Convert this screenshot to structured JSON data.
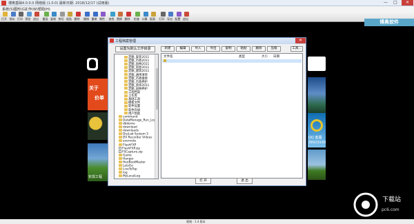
{
  "window": {
    "title": "博奥基础4.0.0.0 网络版 (1.0.0) 最新日期: 2018/12/17 (试用版)",
    "min_glyph": "—",
    "max_glyph": "□",
    "close_glyph": "✕"
  },
  "menu": [
    "系统(S)",
    "图形(G)",
    "工作(W)",
    "帮助(H)"
  ],
  "toolbar": {
    "items": [
      {
        "label": "打开",
        "color": "#e0b43a"
      },
      {
        "label": "保存",
        "color": "#4b7bc8"
      },
      {
        "label": "打印",
        "color": "#666666"
      },
      {
        "label": "预览",
        "color": "#5a9bd5"
      },
      {
        "label": "退出",
        "color": "#c94a3a"
      },
      {
        "label": "重画",
        "color": "#6ab04c"
      },
      {
        "label": "复制",
        "color": "#3a8bc9"
      },
      {
        "label": "剪切",
        "color": "#999999"
      },
      {
        "label": "粘贴",
        "color": "#c9a23a"
      },
      {
        "label": "删除",
        "color": "#cc3333"
      },
      {
        "label": "撤销",
        "color": "#3a6fc9"
      },
      {
        "label": "重做",
        "color": "#3a6fc9"
      },
      {
        "label": "属性",
        "color": "#8a5ac9"
      },
      {
        "label": "查找",
        "color": "#3aa0c9"
      },
      {
        "label": "替换",
        "color": "#c9703a"
      },
      {
        "label": "删除",
        "color": "#cc3333"
      },
      {
        "label": "检查",
        "color": "#6ab04c"
      },
      {
        "label": "计算",
        "color": "#3a8bc9"
      },
      {
        "label": "报表",
        "color": "#c9a23a"
      },
      {
        "label": "打印",
        "color": "#666666"
      },
      {
        "label": "导出",
        "color": "#4b7bc8"
      },
      {
        "label": "配置",
        "color": "#8a5ac9"
      },
      {
        "label": "退出",
        "color": "#c94a3a"
      }
    ],
    "brand": "博奥软件"
  },
  "desktop": {
    "promo_red_line1": "关于",
    "promo_red_line2": "价单",
    "landscape_label": "实现工程",
    "qq_promo_text": "QQ 客服",
    "qq_promo_number": "38929160"
  },
  "watermark": {
    "text": "下载站",
    "url": "pc6.com"
  },
  "status": "就绪 - 1.4 版本",
  "dialog": {
    "title": "工程档案管理",
    "set_dir_button": "设置为默认工作目录",
    "tree_items": [
      {
        "label": "定额_安装2011",
        "type": "folder",
        "indent": 2
      },
      {
        "label": "定额_市政2011",
        "type": "folder",
        "indent": 2
      },
      {
        "label": "定额_园林2011",
        "type": "folder",
        "indent": 2
      },
      {
        "label": "定额_房屋2011",
        "type": "folder",
        "indent": 2
      },
      {
        "label": "定额_建筑2011",
        "type": "folder",
        "indent": 2
      },
      {
        "label": "定额_通用清单",
        "type": "folder",
        "indent": 2
      },
      {
        "label": "定额_市政维修",
        "type": "folder",
        "indent": 2
      },
      {
        "label": "定额_市政养护",
        "type": "folder",
        "indent": 2
      },
      {
        "label": "定额_装饰2011",
        "type": "folder",
        "indent": 2
      },
      {
        "label": "定额_园林养护",
        "type": "folder",
        "indent": 2
      },
      {
        "label": "工程档案",
        "type": "folder",
        "indent": 2
      },
      {
        "label": "工作库",
        "type": "folder",
        "indent": 2
      },
      {
        "label": "基础工具",
        "type": "folder",
        "indent": 2
      },
      {
        "label": "模板文件",
        "type": "folder",
        "indent": 2
      },
      {
        "label": "软件设置",
        "type": "folder",
        "indent": 2
      },
      {
        "label": "软件升级",
        "type": "folder",
        "indent": 2
      },
      {
        "label": "用户帮助",
        "type": "folder",
        "indent": 2
      },
      {
        "label": "command",
        "type": "folder",
        "indent": 1
      },
      {
        "label": "DataManage_Run_Log",
        "type": "folder",
        "indent": 1
      },
      {
        "label": "dbdemo",
        "type": "folder",
        "indent": 1
      },
      {
        "label": "download",
        "type": "folder",
        "indent": 1
      },
      {
        "label": "downloads",
        "type": "folder",
        "indent": 1
      },
      {
        "label": "DrpLab System 5",
        "type": "folder",
        "indent": 1
      },
      {
        "label": "DV Recorder Videos",
        "type": "folder",
        "indent": 1
      },
      {
        "label": "evernote",
        "type": "folder",
        "indent": 1
      },
      {
        "label": "FlashFXP",
        "type": "folder",
        "indent": 1
      },
      {
        "label": "FlashFXP.zip",
        "type": "file",
        "indent": 1
      },
      {
        "label": "FSCapture.zip",
        "type": "file",
        "indent": 1
      },
      {
        "label": "Game",
        "type": "folder",
        "indent": 1
      },
      {
        "label": "Hanger",
        "type": "folder",
        "indent": 1
      },
      {
        "label": "HeoBootMaster",
        "type": "folder",
        "indent": 1
      },
      {
        "label": "LetsGo",
        "type": "folder",
        "indent": 1
      },
      {
        "label": "LiveToTop",
        "type": "folder",
        "indent": 1
      },
      {
        "label": "log",
        "type": "folder",
        "indent": 1
      },
      {
        "label": "MyLocalLog",
        "type": "folder",
        "indent": 1
      }
    ],
    "buttons": [
      "新建",
      "编辑",
      "导入",
      "导出",
      "复制",
      "粘贴",
      "删除",
      "压缩"
    ],
    "more_button": "工具...",
    "columns": [
      "文件名",
      "类型",
      "大小",
      "日期"
    ],
    "open_button": "打 开",
    "exit_button": "退 出"
  }
}
